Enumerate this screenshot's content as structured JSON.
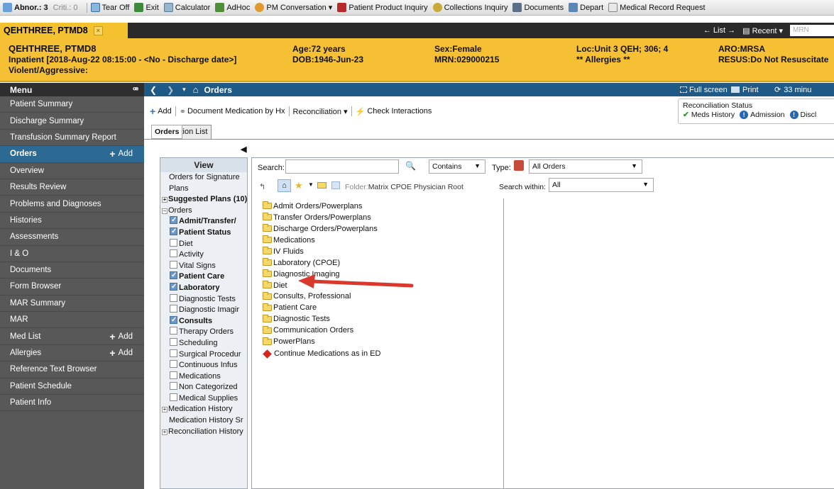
{
  "toolbar": {
    "items": [
      {
        "label": "Abnor.: 3",
        "icon": "abnormal-icon"
      },
      {
        "label": "Criti.: 0",
        "icon": "critical-icon"
      },
      {
        "label": "Tear Off",
        "icon": "tear-off-icon"
      },
      {
        "label": "Exit",
        "icon": "exit-icon"
      },
      {
        "label": "Calculator",
        "icon": "calculator-icon"
      },
      {
        "label": "AdHoc",
        "icon": "adhoc-icon"
      },
      {
        "label": "PM Conversation ▾",
        "icon": "pm-conversation-icon"
      },
      {
        "label": "Patient Product Inquiry",
        "icon": "product-inquiry-icon"
      },
      {
        "label": "Collections Inquiry",
        "icon": "collections-icon"
      },
      {
        "label": "Documents",
        "icon": "documents-icon"
      },
      {
        "label": "Depart",
        "icon": "depart-icon"
      },
      {
        "label": "Medical Record Request",
        "icon": "medical-record-icon"
      }
    ]
  },
  "patient_bar": {
    "tab_name": "QEHTHREE, PTMD8",
    "close": "×",
    "list_label": "List",
    "recent_label": "Recent",
    "mrn_placeholder": "MRN"
  },
  "banner": {
    "name": "QEHTHREE, PTMD8",
    "encounter": "Inpatient [2018-Aug-22 08:15:00 - <No - Discharge date>]",
    "alert": "Violent/Aggressive:",
    "age": "Age:72 years",
    "dob": "DOB:1946-Jun-23",
    "sex": "Sex:Female",
    "mrn": "MRN:029000215",
    "location": "Loc:Unit 3 QEH; 306; 4",
    "allergies": "** Allergies **",
    "aro": "ARO:MRSA",
    "resus": "RESUS:Do Not Resuscitate"
  },
  "menu": {
    "title": "Menu",
    "pin": "ꟹ",
    "add_label": "Add",
    "items": [
      {
        "label": "Patient Summary"
      },
      {
        "label": "Discharge Summary"
      },
      {
        "label": "Transfusion Summary Report"
      },
      {
        "label": "Orders"
      },
      {
        "label": "Overview"
      },
      {
        "label": "Results Review"
      },
      {
        "label": "Problems and Diagnoses"
      },
      {
        "label": "Histories"
      },
      {
        "label": "Assessments"
      },
      {
        "label": "I & O"
      },
      {
        "label": "Documents"
      },
      {
        "label": "Form Browser"
      },
      {
        "label": "MAR Summary"
      },
      {
        "label": "MAR"
      },
      {
        "label": "Med List"
      },
      {
        "label": "Allergies"
      },
      {
        "label": "Reference Text Browser"
      },
      {
        "label": "Patient Schedule"
      },
      {
        "label": "Patient Info"
      }
    ]
  },
  "content_header": {
    "title": "Orders",
    "full_screen": "Full screen",
    "print": "Print",
    "refresh": "33 minu"
  },
  "actions": {
    "add": "Add",
    "document_med": "Document Medication by Hx",
    "reconciliation": "Reconciliation ▾",
    "check_interactions": "Check Interactions",
    "recon_status_title": "Reconciliation Status",
    "meds_history": "Meds History",
    "admission": "Admission",
    "discharge": "Discl"
  },
  "tabs": {
    "orders": "Orders",
    "medication_list": "Medication List"
  },
  "view": {
    "title": "View",
    "items": [
      {
        "label": "Orders for Signature"
      },
      {
        "label": "Plans"
      },
      {
        "label": "Suggested Plans (10)"
      },
      {
        "label": "Orders"
      },
      {
        "label": "Admit/Transfer/"
      },
      {
        "label": "Patient Status"
      },
      {
        "label": "Diet"
      },
      {
        "label": "Activity"
      },
      {
        "label": "Vital Signs"
      },
      {
        "label": "Patient Care"
      },
      {
        "label": "Laboratory"
      },
      {
        "label": "Diagnostic Tests"
      },
      {
        "label": "Diagnostic Imagir"
      },
      {
        "label": "Consults"
      },
      {
        "label": "Therapy Orders"
      },
      {
        "label": "Scheduling"
      },
      {
        "label": "Surgical Procedur"
      },
      {
        "label": "Continuous Infus"
      },
      {
        "label": "Medications"
      },
      {
        "label": "Non Categorized"
      },
      {
        "label": "Medical Supplies"
      },
      {
        "label": "Medication History"
      },
      {
        "label": "Medication History Sr"
      },
      {
        "label": "Reconciliation History"
      }
    ]
  },
  "search": {
    "label": "Search:",
    "value": "",
    "mode": "Contains",
    "type_label": "Type:",
    "type_value": "All Orders",
    "folder_label": "Folder:",
    "folder_value": "Matrix CPOE Physician Root",
    "within_label": "Search within:",
    "within_value": "All"
  },
  "folders": [
    {
      "label": "Admit Orders/Powerplans"
    },
    {
      "label": "Transfer Orders/Powerplans"
    },
    {
      "label": "Discharge Orders/Powerplans"
    },
    {
      "label": "Medications"
    },
    {
      "label": "IV Fluids"
    },
    {
      "label": "Laboratory (CPOE)"
    },
    {
      "label": "Diagnostic Imaging"
    },
    {
      "label": "Diet"
    },
    {
      "label": "Consults, Professional"
    },
    {
      "label": "Patient Care"
    },
    {
      "label": "Diagnostic Tests"
    },
    {
      "label": "Communication Orders"
    },
    {
      "label": "PowerPlans"
    }
  ],
  "orderable": {
    "label": "Continue Medications as in ED"
  },
  "colors": {
    "banner": "#f5c034",
    "header_blue": "#1f5a86",
    "menu_bg": "#585858",
    "annotation_arrow": "#d9392d"
  }
}
